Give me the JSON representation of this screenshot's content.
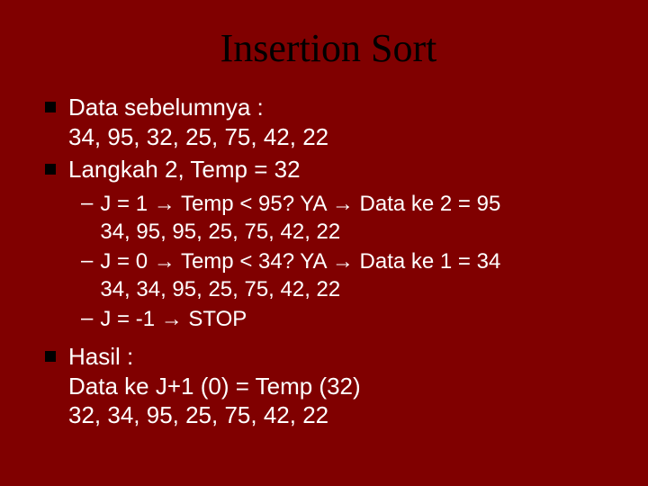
{
  "title": "Insertion Sort",
  "bullets": {
    "b1": {
      "line1": "Data sebelumnya :",
      "line2": "34, 95, 32, 25, 75, 42, 22"
    },
    "b2": {
      "line1": "Langkah 2, Temp = 32"
    },
    "subs": {
      "s1": {
        "line1": "J = 1 → Temp < 95? YA → Data ke 2 = 95",
        "line2": "34, 95, 95, 25, 75, 42, 22"
      },
      "s2": {
        "line1": "J = 0 → Temp < 34? YA → Data ke 1 = 34",
        "line2": "34, 34, 95, 25, 75, 42, 22"
      },
      "s3": {
        "line1": "J = -1 → STOP"
      }
    },
    "b3": {
      "line1": "Hasil :",
      "line2": "Data ke J+1 (0) = Temp (32)",
      "line3": "32, 34, 95, 25, 75, 42, 22"
    }
  },
  "dash": "–"
}
